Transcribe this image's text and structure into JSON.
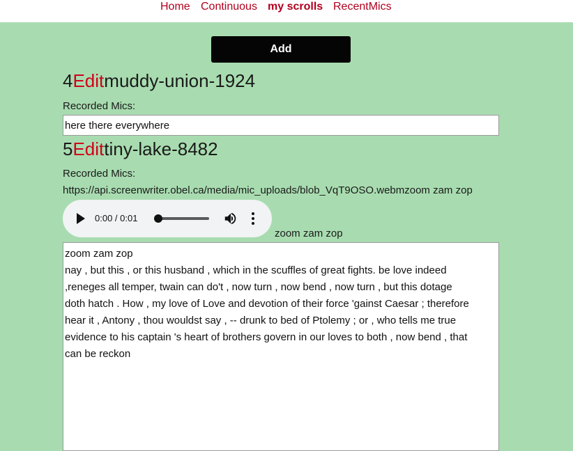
{
  "nav": {
    "home": "Home",
    "continuous": "Continuous",
    "my_scrolls": "my scrolls",
    "recent_mics": "RecentMics"
  },
  "add_button": "Add",
  "scrolls": [
    {
      "id": "4",
      "edit_label": "Edit",
      "name": "muddy-union-1924",
      "recorded_mics_label": "Recorded Mics:",
      "input_value": "here there everywhere"
    },
    {
      "id": "5",
      "edit_label": "Edit",
      "name": "tiny-lake-8482",
      "recorded_mics_label": "Recorded Mics:",
      "mic_url": "https://api.screenwriter.obel.ca/media/mic_uploads/blob_VqT9OSO.webmzoom zam zop",
      "audio": {
        "time": "0:00 / 0:01",
        "progress": 0
      },
      "audio_caption": "zoom zam zop",
      "text_lines": [
        "zoom zam zop",
        "",
        "nay , but this , or this husband , which in the scuffles of great fights. be love indeed",
        ",reneges all temper, twain can do't , now turn , now bend , now turn , but this dotage",
        "doth hatch . How , my love of Love and devotion of their force 'gainst Caesar ; therefore",
        "hear it , Antony , thou wouldst say , -- drunk to bed of Ptolemy ; or , who tells me true",
        "evidence to his captain 's heart of brothers govern in our loves to both , now bend , that",
        "can be reckon"
      ]
    }
  ],
  "colors": {
    "page_bg": "#a8dcb0",
    "link": "#b0001e",
    "edit": "#d0001a",
    "button_bg": "#050505"
  },
  "icons": [
    "play-icon",
    "volume-icon",
    "more-options-icon"
  ]
}
